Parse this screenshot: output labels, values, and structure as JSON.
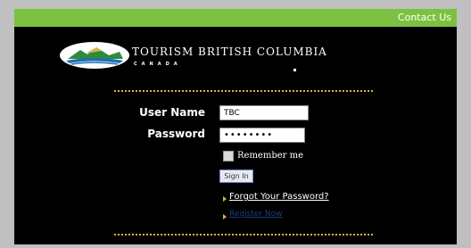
{
  "header": {
    "contact_label": "Contact Us",
    "bar_color": "#7cc242"
  },
  "brand": {
    "title": "TOURISM BRITISH COLUMBIA",
    "subtitle": "CANADA",
    "logo_icon": "bc-mountain-logo-icon"
  },
  "login": {
    "username_label": "User Name",
    "username_value": "TBC",
    "password_label": "Password",
    "password_value": "••••••••",
    "remember_label": "Remember me",
    "remember_checked": false,
    "signin_label": "Sign In",
    "forgot_label": "Forgot Your Password?",
    "register_label": "Register Now"
  },
  "colors": {
    "accent_gold": "#d9b24a",
    "register_link": "#1f3d7a"
  }
}
